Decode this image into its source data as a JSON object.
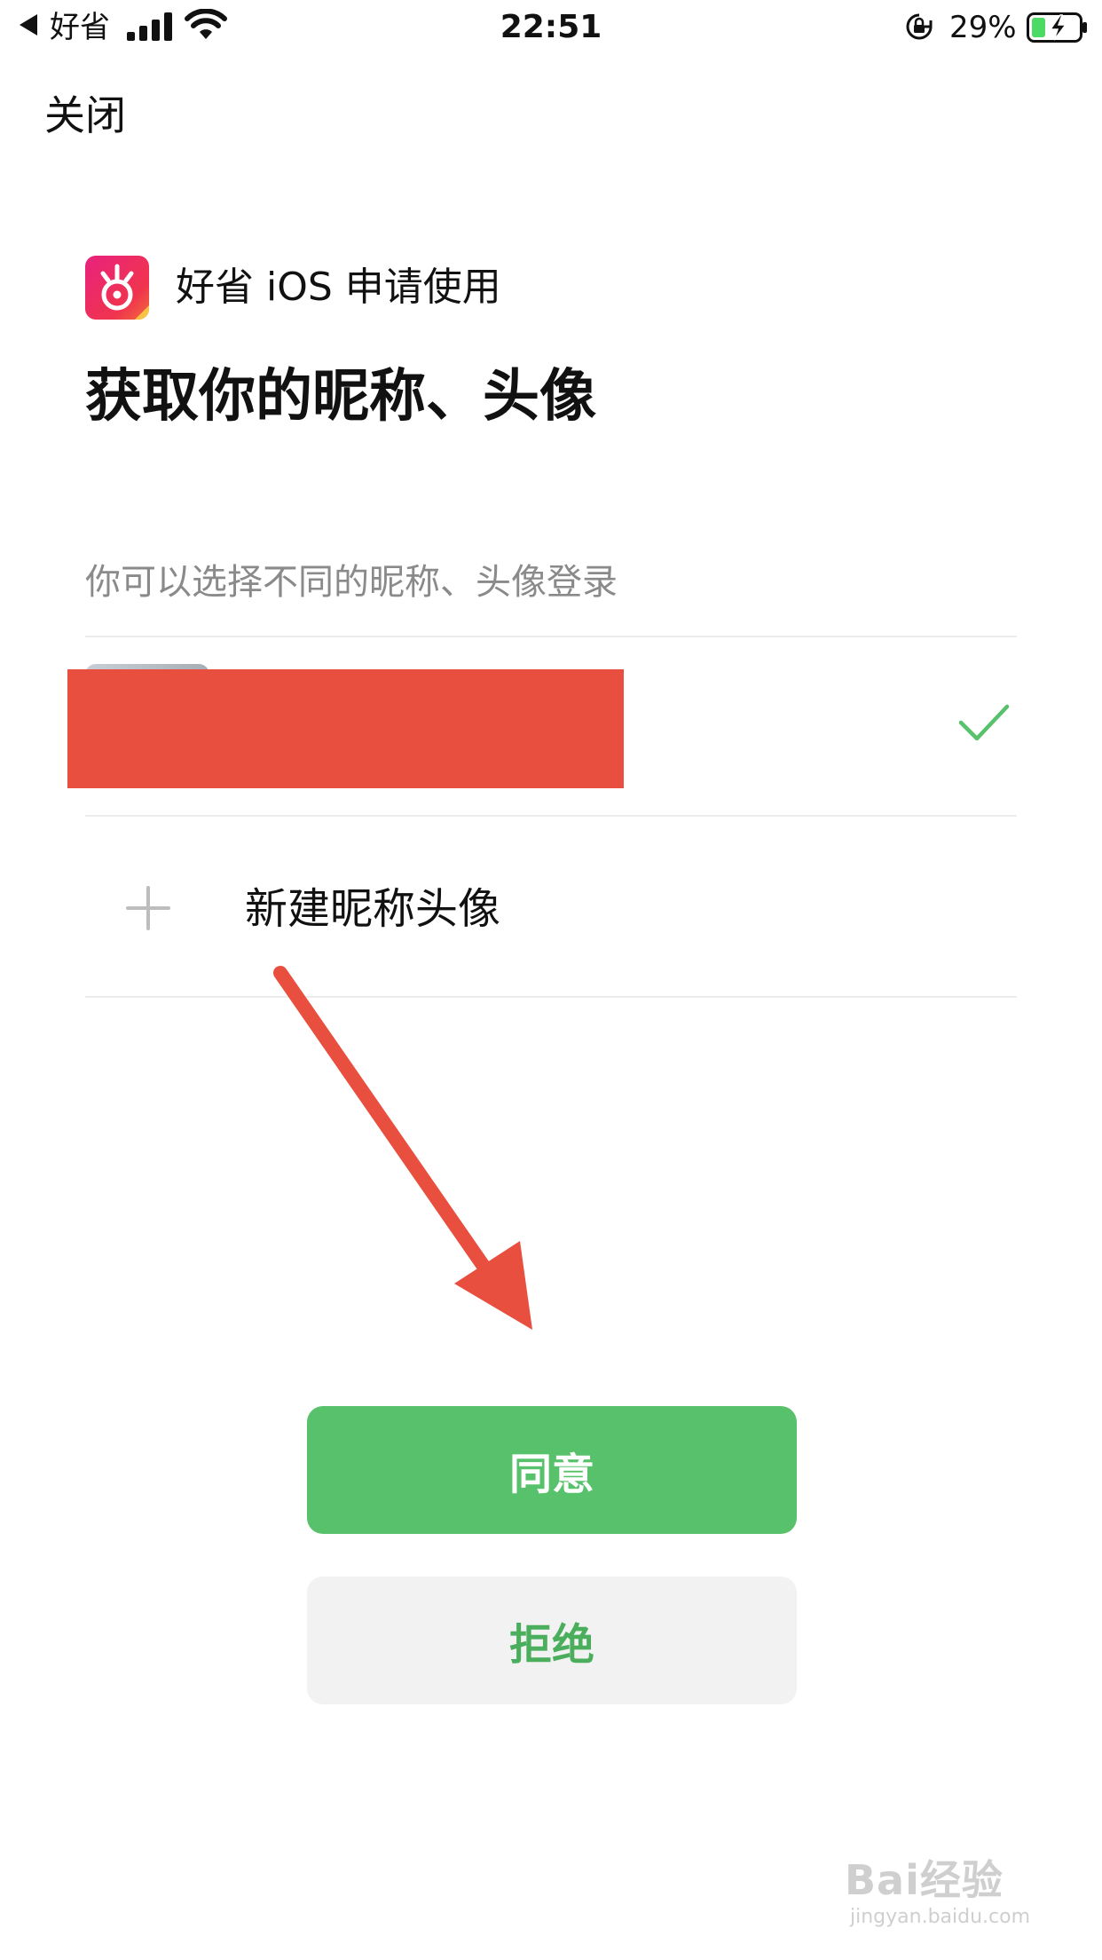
{
  "status_bar": {
    "back_app": "好省",
    "time": "22:51",
    "battery_percent": "29%",
    "battery_level": 0.29
  },
  "close_label": "关闭",
  "app": {
    "request_text": "好省 iOS 申请使用",
    "logo_color": "#e8227e"
  },
  "title": "获取你的昵称、头像",
  "hint": "你可以选择不同的昵称、头像登录",
  "account": {
    "selected": true
  },
  "new_profile_label": "新建昵称头像",
  "buttons": {
    "agree": "同意",
    "reject": "拒绝"
  },
  "colors": {
    "accent_green": "#58c16b",
    "annotation_red": "#e94f3f"
  },
  "watermark": {
    "logo": "Bai经验",
    "url": "jingyan.baidu.com"
  }
}
